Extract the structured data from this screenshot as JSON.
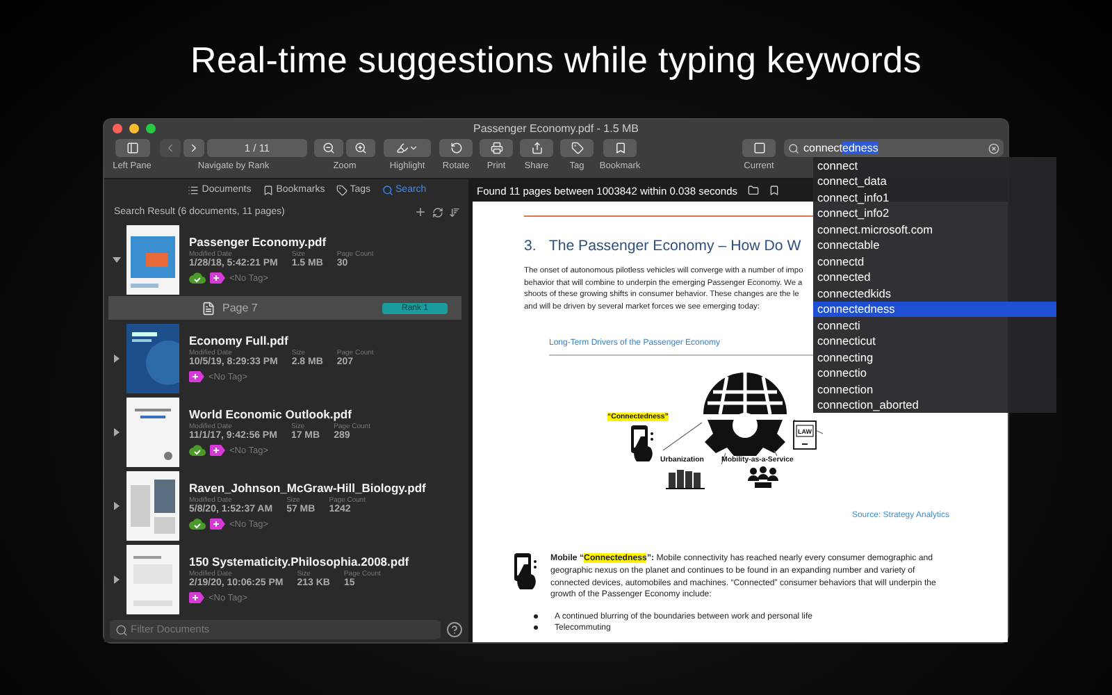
{
  "headline": "Real-time suggestions while typing keywords",
  "window": {
    "title": "Passenger Economy.pdf - 1.5 MB"
  },
  "toolbar": {
    "items": [
      {
        "kind": "left-pane",
        "label": "Left Pane"
      },
      {
        "kind": "nav",
        "label": "Navigate by Rank",
        "page": "1 / 11",
        "back_disabled": true
      },
      {
        "kind": "zoom",
        "label": "Zoom"
      },
      {
        "kind": "highlight",
        "label": "Highlight"
      },
      {
        "kind": "rotate",
        "label": "Rotate"
      },
      {
        "kind": "print",
        "label": "Print"
      },
      {
        "kind": "share",
        "label": "Share"
      },
      {
        "kind": "tag",
        "label": "Tag"
      },
      {
        "kind": "bookmark",
        "label": "Bookmark"
      },
      {
        "kind": "current",
        "label": "Current"
      }
    ],
    "search": {
      "value": "connect",
      "completion": "edness"
    }
  },
  "suggestions": [
    {
      "label": "connect",
      "selected": false
    },
    {
      "label": "connect_data",
      "selected": false
    },
    {
      "label": "connect_info1",
      "selected": false
    },
    {
      "label": "connect_info2",
      "selected": false
    },
    {
      "label": "connect.microsoft.com",
      "selected": false
    },
    {
      "label": "connectable",
      "selected": false
    },
    {
      "label": "connectd",
      "selected": false
    },
    {
      "label": "connected",
      "selected": false
    },
    {
      "label": "connectedkids",
      "selected": false
    },
    {
      "label": "connectedness",
      "selected": true
    },
    {
      "label": "connecti",
      "selected": false
    },
    {
      "label": "connecticut",
      "selected": false
    },
    {
      "label": "connecting",
      "selected": false
    },
    {
      "label": "connectio",
      "selected": false
    },
    {
      "label": "connection",
      "selected": false
    },
    {
      "label": "connection_aborted",
      "selected": false
    }
  ],
  "sidebar": {
    "tabs": [
      {
        "kind": "documents",
        "label": "Documents",
        "selected": false
      },
      {
        "kind": "bookmarks",
        "label": "Bookmarks",
        "selected": false
      },
      {
        "kind": "tags",
        "label": "Tags",
        "selected": false
      },
      {
        "kind": "search",
        "label": "Search",
        "selected": true
      }
    ],
    "result_header": "Search Result (6 documents, 11 pages)",
    "documents": [
      {
        "name": "Passenger Economy.pdf",
        "modified_label": "Modified Date",
        "modified": "1/28/18, 5:42:21 PM",
        "size_label": "Size",
        "size": "1.5 MB",
        "count_label": "Page Count",
        "count": "30",
        "synced": true,
        "tag": "<No Tag>",
        "expanded": true,
        "hits": [
          {
            "label": "Page 7",
            "rank": "Rank 1",
            "selected": true
          }
        ]
      },
      {
        "name": "Economy Full.pdf",
        "modified_label": "Modified Date",
        "modified": "10/5/19, 8:29:33 PM",
        "size_label": "Size",
        "size": "2.8 MB",
        "count_label": "Page Count",
        "count": "207",
        "synced": false,
        "tag": "<No Tag>",
        "expanded": false
      },
      {
        "name": "World Economic Outlook.pdf",
        "modified_label": "Modified Date",
        "modified": "11/1/17, 9:42:56 PM",
        "size_label": "Size",
        "size": "17 MB",
        "count_label": "Page Count",
        "count": "289",
        "synced": true,
        "tag": "<No Tag>",
        "expanded": false
      },
      {
        "name": "Raven_Johnson_McGraw-Hill_Biology.pdf",
        "modified_label": "Modified Date",
        "modified": "5/8/20, 1:52:37 AM",
        "size_label": "Size",
        "size": "57 MB",
        "count_label": "Page Count",
        "count": "1242",
        "synced": true,
        "tag": "<No Tag>",
        "expanded": false
      },
      {
        "name": "150 Systematicity.Philosophia.2008.pdf",
        "modified_label": "Modified Date",
        "modified": "2/19/20, 10:06:25 PM",
        "size_label": "Size",
        "size": "213 KB",
        "count_label": "Page Count",
        "count": "15",
        "synced": false,
        "tag": "<No Tag>",
        "expanded": false
      }
    ],
    "filter": {
      "placeholder": "Filter Documents"
    }
  },
  "viewer": {
    "status": "Found 11 pages between 1003842 within 0.038 seconds",
    "page": {
      "heading_number": "3.",
      "heading": "The Passenger Economy – How Do W",
      "lines": [
        "The onset of autonomous pilotless vehicles will converge with a number of impo",
        "behavior that will combine to underpin the emerging Passenger Economy. We a",
        "shoots of these growing shifts in consumer behavior. These changes are the le",
        "and will be driven by several market forces we see emerging today:"
      ],
      "link": "Long-Term Drivers of the Passenger Economy",
      "diagram": {
        "connectedness": "“Connectedness”",
        "urbanization": "Urbanization",
        "mobility": "Mobility-as-a-Service",
        "law": "LAW"
      },
      "source": "Source: Strategy Analytics",
      "paragraph": [
        {
          "text": "Mobile “",
          "bold": true,
          "highlighted": false
        },
        {
          "text": "Connectedness",
          "bold": true,
          "highlighted": true
        },
        {
          "text": "”:",
          "bold": true,
          "highlighted": false
        },
        {
          "text": " Mobile connectivity has reached nearly every consumer demographic and geographic nexus on the planet and continues to be found in an expanding number and variety of connected devices, automobiles and machines. “Connected” consumer behaviors that will underpin the growth of the Passenger Economy include:",
          "bold": false,
          "highlighted": false
        }
      ],
      "bullets": [
        "A continued blurring of the boundaries between work and personal life",
        "Telecommuting"
      ]
    }
  }
}
